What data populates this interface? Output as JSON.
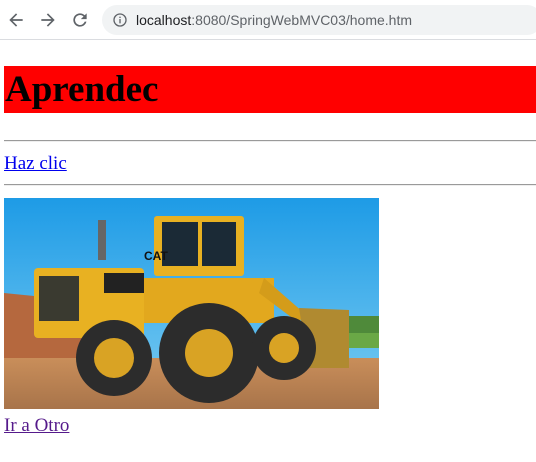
{
  "browser": {
    "url_host": "localhost",
    "url_rest": ":8080/SpringWebMVC03/home.htm",
    "icons": {
      "back": "arrow-left-icon",
      "forward": "arrow-right-icon",
      "reload": "reload-icon",
      "site_info": "info-icon"
    }
  },
  "page": {
    "title": "Aprendec",
    "title_background": "#ff0000",
    "link_clic": "Haz clic",
    "link_otro": "Ir a Otro",
    "image_subject": "yellow wheel loader on dirt site"
  }
}
